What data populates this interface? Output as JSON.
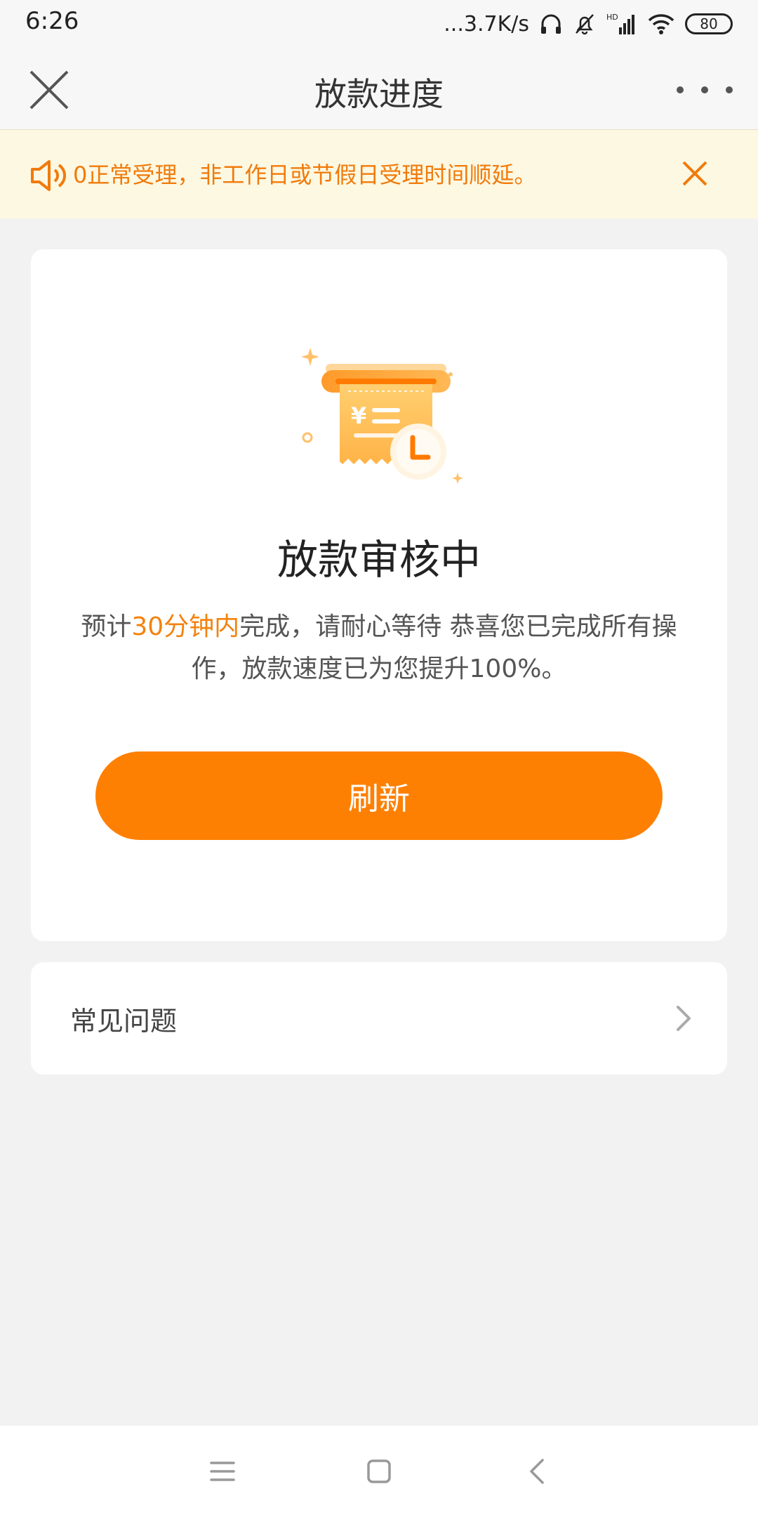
{
  "status_bar": {
    "time": "6:26",
    "network_speed": "...3.7K/s",
    "battery": "80",
    "icons": [
      "headphones-icon",
      "bell-muted-icon",
      "hd-signal-icon",
      "wifi-icon",
      "battery-icon"
    ]
  },
  "nav": {
    "title": "放款进度",
    "close_icon": "close-icon",
    "more_icon": "more-dots-icon"
  },
  "notice": {
    "text": "0正常受理，非工作日或节假日受理时间顺延。",
    "speaker_icon": "speaker-icon",
    "close_icon": "close-icon"
  },
  "status_card": {
    "illustration_icon": "receipt-clock-icon",
    "heading": "放款审核中",
    "desc_prefix": "预计",
    "desc_highlight": "30分钟内",
    "desc_suffix": "完成，请耐心等待 恭喜您已完成所有操作，放款速度已为您提升100%。",
    "refresh_label": "刷新"
  },
  "faq": {
    "label": "常见问题",
    "chevron_icon": "chevron-right-icon"
  },
  "system_nav": {
    "icons": [
      "menu-icon",
      "home-icon",
      "back-icon"
    ]
  },
  "colors": {
    "accent": "#fe8003",
    "notice_bg": "#fdf8e2",
    "notice_text": "#f07b0c"
  }
}
